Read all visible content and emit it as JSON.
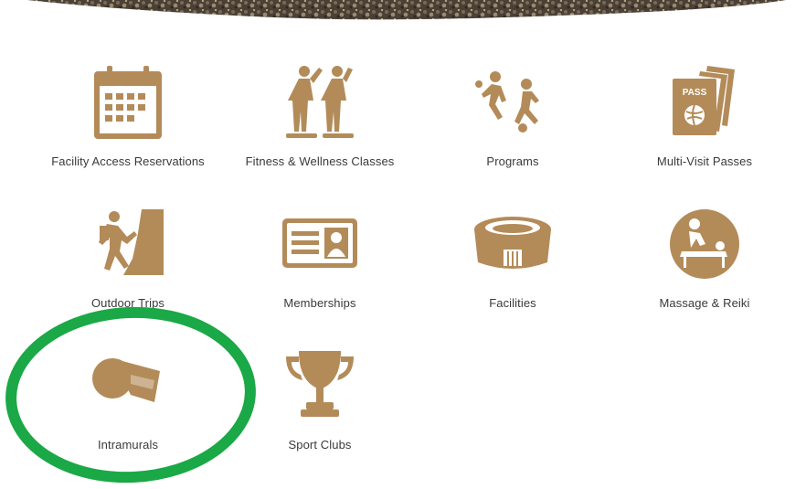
{
  "colors": {
    "icon": "#B38B59",
    "icon_dark": "#8E6B40",
    "label": "#3A3A3A",
    "highlight_ring": "#1BA846"
  },
  "tiles": [
    {
      "label": "Facility Access Reservations",
      "icon": "calendar-icon"
    },
    {
      "label": "Fitness & Wellness Classes",
      "icon": "fitness-figures-icon"
    },
    {
      "label": "Programs",
      "icon": "soccer-players-icon"
    },
    {
      "label": "Multi-Visit Passes",
      "icon": "pass-icon"
    },
    {
      "label": "Outdoor Trips",
      "icon": "climber-icon"
    },
    {
      "label": "Memberships",
      "icon": "id-card-icon"
    },
    {
      "label": "Facilities",
      "icon": "stadium-icon"
    },
    {
      "label": "Massage & Reiki",
      "icon": "massage-icon"
    },
    {
      "label": "Intramurals",
      "icon": "whistle-icon"
    },
    {
      "label": "Sport Clubs",
      "icon": "trophy-icon"
    }
  ],
  "pass_text": "PASS"
}
